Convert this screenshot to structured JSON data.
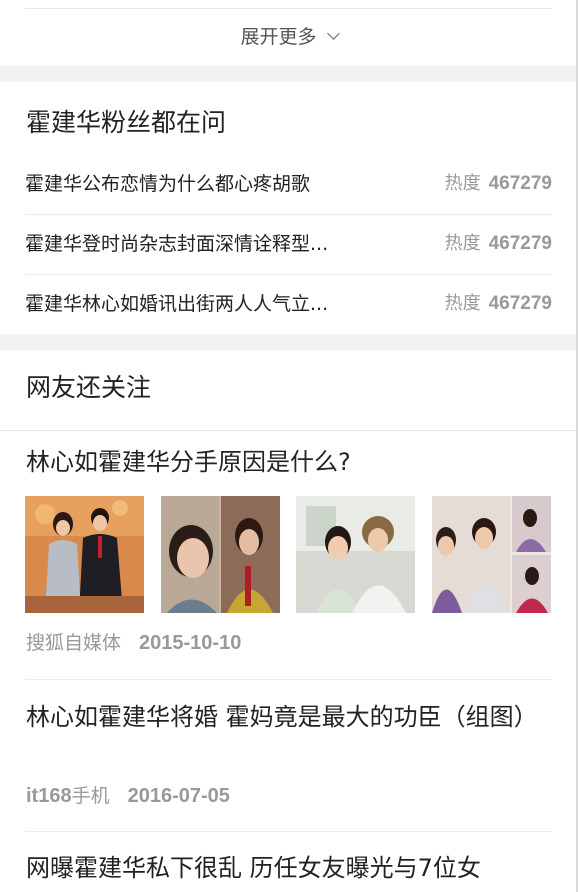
{
  "expand": {
    "label": "展开更多"
  },
  "fans_ask": {
    "title": "霍建华粉丝都在问",
    "items": [
      {
        "question": "霍建华公布恋情为什么都心疼胡歌",
        "heat_label": "热度",
        "heat_value": "467279"
      },
      {
        "question": "霍建华登时尚杂志封面深情诠释型...",
        "heat_label": "热度",
        "heat_value": "467279"
      },
      {
        "question": "霍建华林心如婚讯出街两人人气立...",
        "heat_label": "热度",
        "heat_value": "467279"
      }
    ]
  },
  "also_follow": {
    "title": "网友还关注",
    "articles": [
      {
        "title": "林心如霍建华分手原因是什么?",
        "source": "搜狐自媒体",
        "date": "2015-10-10"
      },
      {
        "title": "林心如霍建华将婚 霍妈竟是最大的功臣（组图）",
        "source_latin": "it168",
        "source": "手机",
        "date": "2016-07-05"
      },
      {
        "title": "网曝霍建华私下很乱 历任女友曝光与7位女"
      }
    ]
  },
  "colors": {
    "background": "#f2f2f2",
    "card": "#ffffff",
    "text_primary": "#222222",
    "text_secondary": "#999999"
  }
}
